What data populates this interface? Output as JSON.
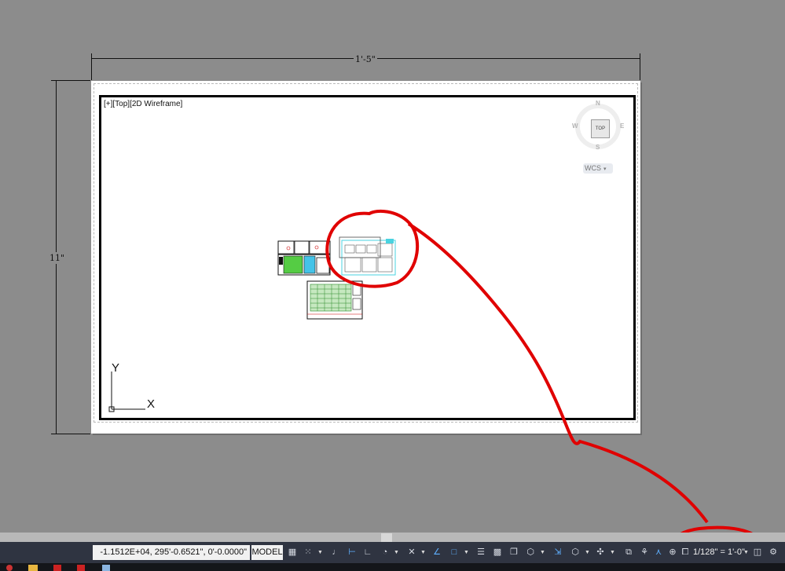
{
  "viewport": {
    "label": "[+][Top][2D Wireframe]"
  },
  "dimensions": {
    "width_label": "1'-5\"",
    "height_label": "11\""
  },
  "viewcube": {
    "north": "N",
    "south": "S",
    "east": "E",
    "west": "W",
    "face": "TOP",
    "ucs_menu": "WCS"
  },
  "ucs_icon": {
    "x_label": "X",
    "y_label": "Y"
  },
  "statusbar": {
    "coordinates": "-1.1512E+04, 295'-0.6521\", 0'-0.0000\"",
    "model_label": "MODEL",
    "annotation_scale": "1/128\" = 1'-0\""
  },
  "colors": {
    "annotation_red": "#e00000",
    "status_bg": "#2f3441",
    "workspace_bg": "#8c8c8c"
  }
}
